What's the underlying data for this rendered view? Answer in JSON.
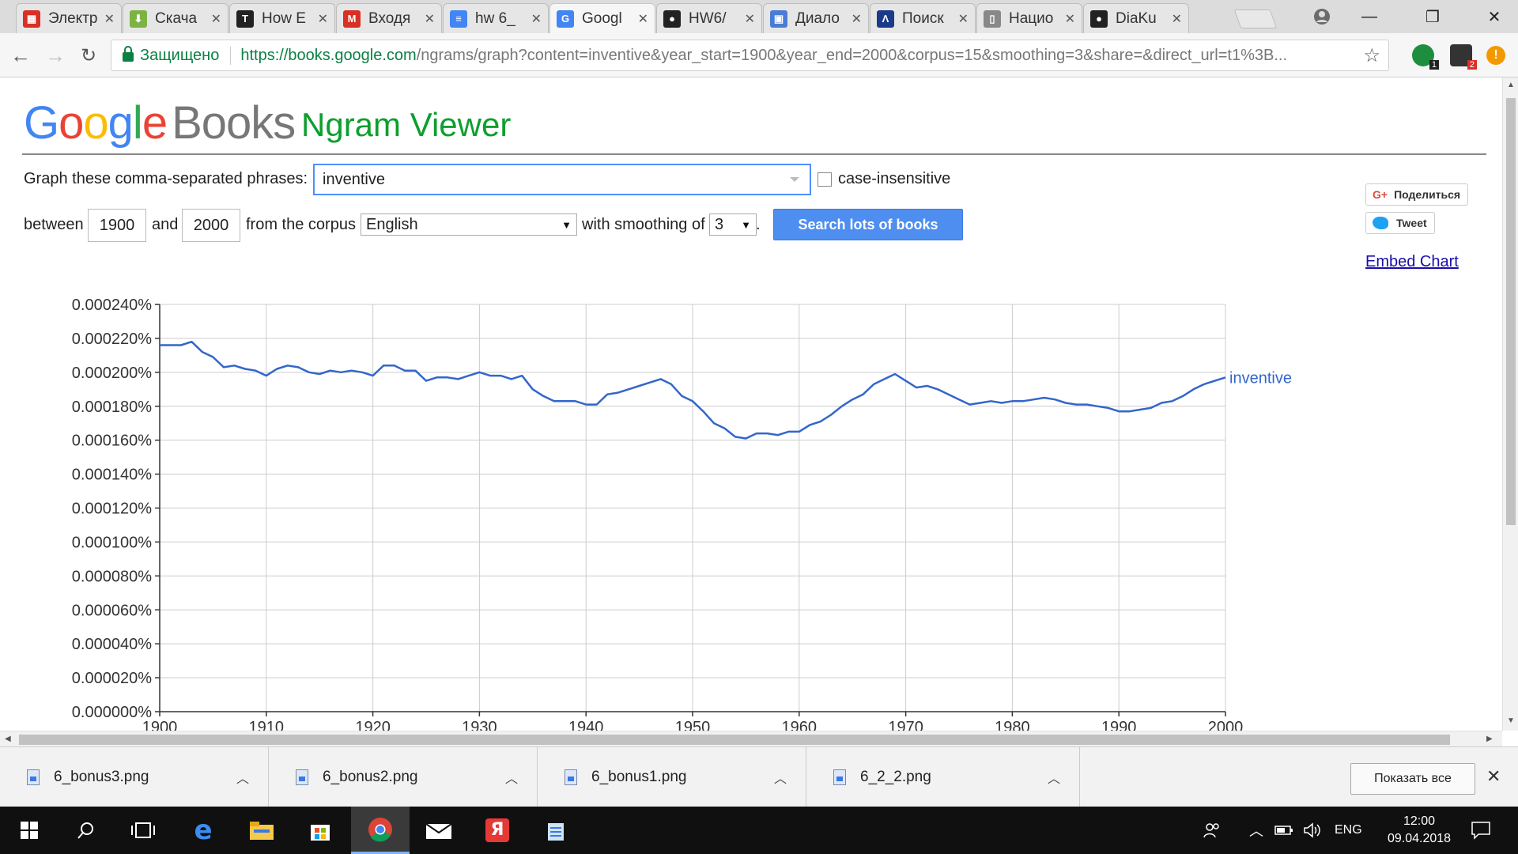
{
  "browser": {
    "tabs": [
      {
        "label": "Электр",
        "color": "#d93025",
        "glyph": "▦"
      },
      {
        "label": "Скача",
        "color": "#7cb342",
        "glyph": "⬇"
      },
      {
        "label": "How E",
        "color": "#222222",
        "glyph": "T"
      },
      {
        "label": "Входя",
        "color": "#d93025",
        "glyph": "M"
      },
      {
        "label": "hw 6_",
        "color": "#4285f4",
        "glyph": "≡"
      },
      {
        "label": "Googl",
        "color": "#4285f4",
        "glyph": "G"
      },
      {
        "label": "HW6/",
        "color": "#222222",
        "glyph": "●"
      },
      {
        "label": "Диало",
        "color": "#4a7cd6",
        "glyph": "▣"
      },
      {
        "label": "Поиск",
        "color": "#1a3a8a",
        "glyph": "Λ"
      },
      {
        "label": "Нацио",
        "color": "#888888",
        "glyph": "▯"
      },
      {
        "label": "DiaKu",
        "color": "#222222",
        "glyph": "●"
      }
    ],
    "close_glyph": "✕",
    "secure_label": "Защищено",
    "url_host": "https://books.google.com",
    "url_path": "/ngrams/graph?content=inventive&year_start=1900&year_end=2000&corpus=15&smoothing=3&share=&direct_url=t1%3B...",
    "ext_badges": [
      "1",
      "2"
    ]
  },
  "page": {
    "logo_google": "Google",
    "logo_books": "Books",
    "title": "Ngram Viewer",
    "phrases_label": "Graph these comma-separated phrases:",
    "phrases_value": "inventive",
    "case_insensitive_label": "case-insensitive",
    "between_label": "between",
    "year_start": "1900",
    "and_label": "and",
    "year_end": "2000",
    "corpus_label": "from the corpus",
    "corpus_value": "English",
    "smoothing_label": "with smoothing of",
    "smoothing_value": "3",
    "period": ".",
    "search_button": "Search lots of books",
    "share_gplus": "Поделиться",
    "share_tweet": "Tweet",
    "embed_chart": "Embed Chart"
  },
  "chart_data": {
    "type": "line",
    "xlim": [
      1900,
      2000
    ],
    "ylim": [
      0,
      0.00024
    ],
    "x_ticks": [
      "1900",
      "1910",
      "1920",
      "1930",
      "1940",
      "1950",
      "1960",
      "1970",
      "1980",
      "1990",
      "2000"
    ],
    "y_ticks": [
      "0.000000%",
      "0.000020%",
      "0.000040%",
      "0.000060%",
      "0.000080%",
      "0.000100%",
      "0.000120%",
      "0.000140%",
      "0.000160%",
      "0.000180%",
      "0.000200%",
      "0.000220%",
      "0.000240%"
    ],
    "series": [
      {
        "name": "inventive",
        "color": "#3366cc",
        "x": [
          1900,
          1901,
          1902,
          1903,
          1904,
          1905,
          1906,
          1907,
          1908,
          1909,
          1910,
          1911,
          1912,
          1913,
          1914,
          1915,
          1916,
          1917,
          1918,
          1919,
          1920,
          1921,
          1922,
          1923,
          1924,
          1925,
          1926,
          1927,
          1928,
          1929,
          1930,
          1931,
          1932,
          1933,
          1934,
          1935,
          1936,
          1937,
          1938,
          1939,
          1940,
          1941,
          1942,
          1943,
          1944,
          1945,
          1946,
          1947,
          1948,
          1949,
          1950,
          1951,
          1952,
          1953,
          1954,
          1955,
          1956,
          1957,
          1958,
          1959,
          1960,
          1961,
          1962,
          1963,
          1964,
          1965,
          1966,
          1967,
          1968,
          1969,
          1970,
          1971,
          1972,
          1973,
          1974,
          1975,
          1976,
          1977,
          1978,
          1979,
          1980,
          1981,
          1982,
          1983,
          1984,
          1985,
          1986,
          1987,
          1988,
          1989,
          1990,
          1991,
          1992,
          1993,
          1994,
          1995,
          1996,
          1997,
          1998,
          1999,
          2000
        ],
        "y": [
          0.000216,
          0.000216,
          0.000216,
          0.000218,
          0.000212,
          0.000209,
          0.000203,
          0.000204,
          0.000202,
          0.000201,
          0.000198,
          0.000202,
          0.000204,
          0.000203,
          0.0002,
          0.000199,
          0.000201,
          0.0002,
          0.000201,
          0.0002,
          0.000198,
          0.000204,
          0.000204,
          0.000201,
          0.000201,
          0.000195,
          0.000197,
          0.000197,
          0.000196,
          0.000198,
          0.0002,
          0.000198,
          0.000198,
          0.000196,
          0.000198,
          0.00019,
          0.000186,
          0.000183,
          0.000183,
          0.000183,
          0.000181,
          0.000181,
          0.000187,
          0.000188,
          0.00019,
          0.000192,
          0.000194,
          0.000196,
          0.000193,
          0.000186,
          0.000183,
          0.000177,
          0.00017,
          0.000167,
          0.000162,
          0.000161,
          0.000164,
          0.000164,
          0.000163,
          0.000165,
          0.000165,
          0.000169,
          0.000171,
          0.000175,
          0.00018,
          0.000184,
          0.000187,
          0.000193,
          0.000196,
          0.000199,
          0.000195,
          0.000191,
          0.000192,
          0.00019,
          0.000187,
          0.000184,
          0.000181,
          0.000182,
          0.000183,
          0.000182,
          0.000183,
          0.000183,
          0.000184,
          0.000185,
          0.000184,
          0.000182,
          0.000181,
          0.000181,
          0.00018,
          0.000179,
          0.000177,
          0.000177,
          0.000178,
          0.000179,
          0.000182,
          0.000183,
          0.000186,
          0.00019,
          0.000193,
          0.000195,
          0.000197
        ]
      }
    ]
  },
  "downloads": {
    "items": [
      "6_bonus3.png",
      "6_bonus2.png",
      "6_bonus1.png",
      "6_2_2.png"
    ],
    "show_all": "Показать все"
  },
  "taskbar": {
    "language": "ENG",
    "time": "12:00",
    "date": "09.04.2018"
  }
}
